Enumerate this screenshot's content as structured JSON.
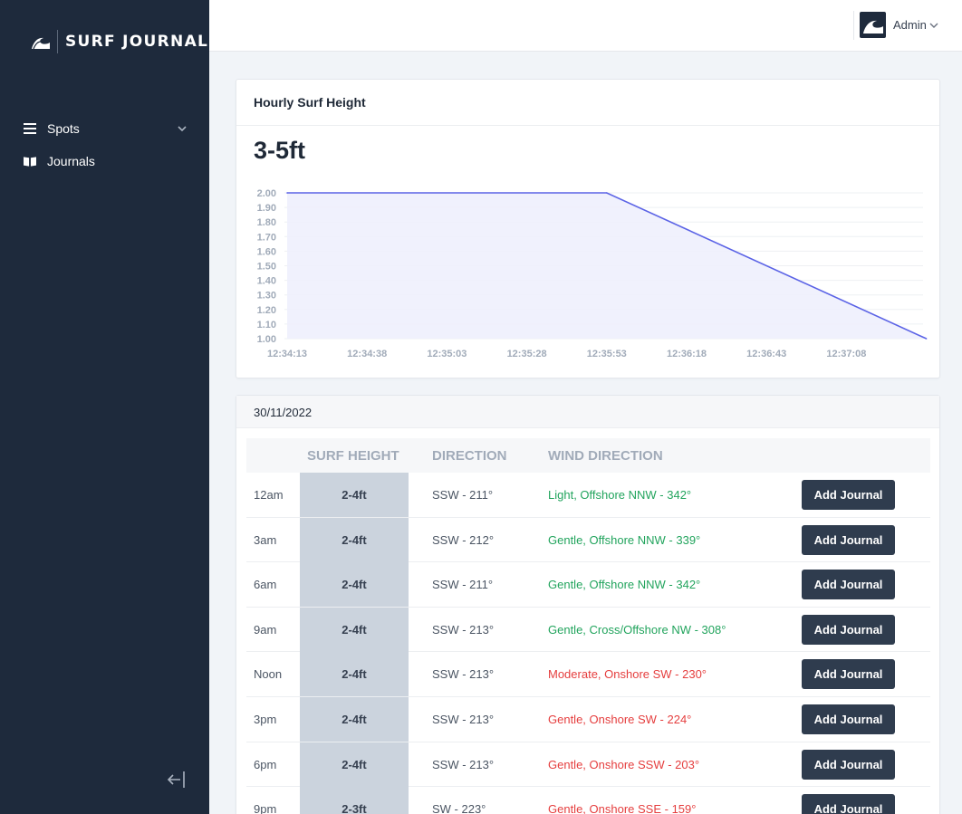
{
  "app": {
    "brand": "SURF JOURNAL"
  },
  "sidebar": {
    "items": [
      {
        "label": "Spots",
        "icon": "menu-icon",
        "has_submenu": true
      },
      {
        "label": "Journals",
        "icon": "book-icon",
        "has_submenu": false
      }
    ],
    "collapse_icon": "collapse-left-icon"
  },
  "topbar": {
    "user_name": "Admin"
  },
  "chart_card": {
    "title": "Hourly Surf Height",
    "value": "3-5ft"
  },
  "chart_data": {
    "type": "area",
    "x": [
      "12:34:13",
      "12:35:53",
      "12:37:33"
    ],
    "values": [
      2.0,
      2.0,
      1.0
    ],
    "x_ticks": [
      "12:34:13",
      "12:34:38",
      "12:35:03",
      "12:35:28",
      "12:35:53",
      "12:36:18",
      "12:36:43",
      "12:37:08"
    ],
    "y_ticks": [
      "1.00",
      "1.10",
      "1.20",
      "1.30",
      "1.40",
      "1.50",
      "1.60",
      "1.70",
      "1.80",
      "1.90",
      "2.00"
    ],
    "ylim": [
      1.0,
      2.0
    ],
    "grid": true,
    "line_color": "#5b63e6",
    "fill_color": "#eef0fd"
  },
  "forecast": {
    "date": "30/11/2022",
    "columns": [
      "",
      "SURF HEIGHT",
      "DIRECTION",
      "WIND DIRECTION"
    ],
    "button_label": "Add Journal",
    "colors": {
      "offshore": "#22a45d",
      "onshore": "#e53e3e"
    },
    "rows": [
      {
        "time": "12am",
        "height": "2-4ft",
        "direction": "SSW - 211°",
        "wind": "Light, Offshore NNW - 342°",
        "wind_type": "offshore"
      },
      {
        "time": "3am",
        "height": "2-4ft",
        "direction": "SSW - 212°",
        "wind": "Gentle, Offshore NNW - 339°",
        "wind_type": "offshore"
      },
      {
        "time": "6am",
        "height": "2-4ft",
        "direction": "SSW - 211°",
        "wind": "Gentle, Offshore NNW - 342°",
        "wind_type": "offshore"
      },
      {
        "time": "9am",
        "height": "2-4ft",
        "direction": "SSW - 213°",
        "wind": "Gentle, Cross/Offshore NW - 308°",
        "wind_type": "offshore"
      },
      {
        "time": "Noon",
        "height": "2-4ft",
        "direction": "SSW - 213°",
        "wind": "Moderate, Onshore SW - 230°",
        "wind_type": "onshore"
      },
      {
        "time": "3pm",
        "height": "2-4ft",
        "direction": "SSW - 213°",
        "wind": "Gentle, Onshore SW - 224°",
        "wind_type": "onshore"
      },
      {
        "time": "6pm",
        "height": "2-4ft",
        "direction": "SSW - 213°",
        "wind": "Gentle, Onshore SSW - 203°",
        "wind_type": "onshore"
      },
      {
        "time": "9pm",
        "height": "2-3ft",
        "direction": "SW - 223°",
        "wind": "Gentle, Onshore SSE - 159°",
        "wind_type": "onshore"
      }
    ]
  }
}
